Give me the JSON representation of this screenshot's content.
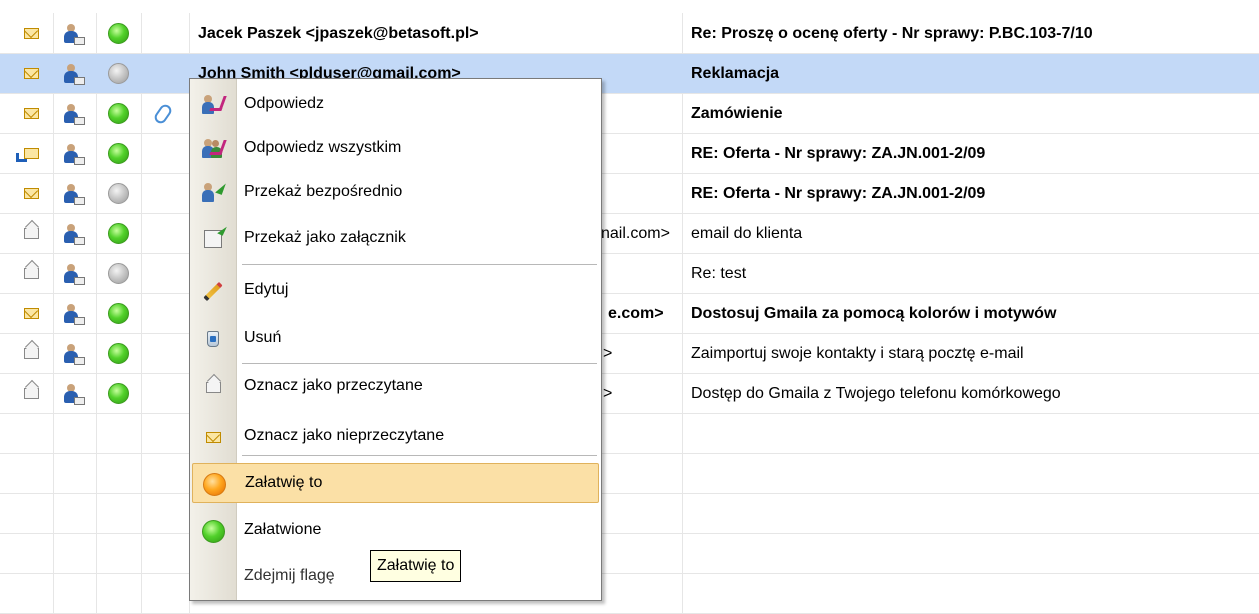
{
  "emails": [
    {
      "icon": "envelope-unread-icon",
      "flag": "green",
      "attachment": false,
      "from": "Jacek Paszek <jpaszek@betasoft.pl>",
      "subject": "Re: Proszę o ocenę oferty - Nr sprawy: P.BC.103-7/10",
      "bold": true,
      "selected": false
    },
    {
      "icon": "envelope-unread-icon",
      "flag": "gray",
      "attachment": false,
      "from": "John Smith <plduser@gmail.com>",
      "subject": "Reklamacja",
      "bold": true,
      "selected": true
    },
    {
      "icon": "envelope-unread-icon",
      "flag": "green",
      "attachment": true,
      "from": "",
      "subject": "Zamówienie",
      "bold": true,
      "selected": false
    },
    {
      "icon": "envelope-replied-icon",
      "flag": "green",
      "attachment": false,
      "from": "",
      "subject": "RE: Oferta - Nr sprawy: ZA.JN.001-2/09",
      "bold": true,
      "selected": false
    },
    {
      "icon": "envelope-unread-icon",
      "flag": "gray",
      "attachment": false,
      "from": "",
      "subject": "RE: Oferta - Nr sprawy: ZA.JN.001-2/09",
      "bold": true,
      "selected": false
    },
    {
      "icon": "envelope-read-icon",
      "flag": "green",
      "attachment": false,
      "from": "nail.com>",
      "subject": "email do klienta",
      "bold": false,
      "selected": false
    },
    {
      "icon": "envelope-read-icon",
      "flag": "gray",
      "attachment": false,
      "from": "",
      "subject": "Re: test",
      "bold": false,
      "selected": false
    },
    {
      "icon": "envelope-unread-icon",
      "flag": "green",
      "attachment": false,
      "from": "e.com>",
      "subject": "Dostosuj Gmaila za pomocą kolorów i motywów",
      "bold": true,
      "selected": false
    },
    {
      "icon": "envelope-read-icon",
      "flag": "green",
      "attachment": false,
      "from": ">",
      "subject": "Zaimportuj swoje kontakty i starą pocztę e-mail",
      "bold": false,
      "selected": false
    },
    {
      "icon": "envelope-read-icon",
      "flag": "green",
      "attachment": false,
      "from": ">",
      "subject": "Dostęp do Gmaila z Twojego telefonu komórkowego",
      "bold": false,
      "selected": false
    }
  ],
  "context_menu": {
    "items": [
      {
        "label": "Odpowiedz",
        "icon": "reply-icon"
      },
      {
        "label": "Odpowiedz wszystkim",
        "icon": "reply-all-icon"
      },
      {
        "label": "Przekaż bezpośrednio",
        "icon": "forward-icon"
      },
      {
        "label": "Przekaż jako załącznik",
        "icon": "forward-attachment-icon"
      },
      {
        "label": "Edytuj",
        "icon": "pencil-icon"
      },
      {
        "label": "Usuń",
        "icon": "trash-icon"
      },
      {
        "label": "Oznacz jako przeczytane",
        "icon": "envelope-read-icon"
      },
      {
        "label": "Oznacz jako nieprzeczytane",
        "icon": "envelope-unread-icon"
      },
      {
        "label": "Załatwię to",
        "icon": "flag-orange-icon",
        "highlighted": true
      },
      {
        "label": "Załatwione",
        "icon": "flag-green-icon"
      },
      {
        "label": "Zdejmij flagę",
        "icon": ""
      }
    ]
  },
  "tooltip": {
    "text": "Załatwię to"
  },
  "colors": {
    "selected_row": "#c3d9f7",
    "menu_highlight": "#fbe0a6",
    "tooltip_bg": "#ffffe1"
  }
}
